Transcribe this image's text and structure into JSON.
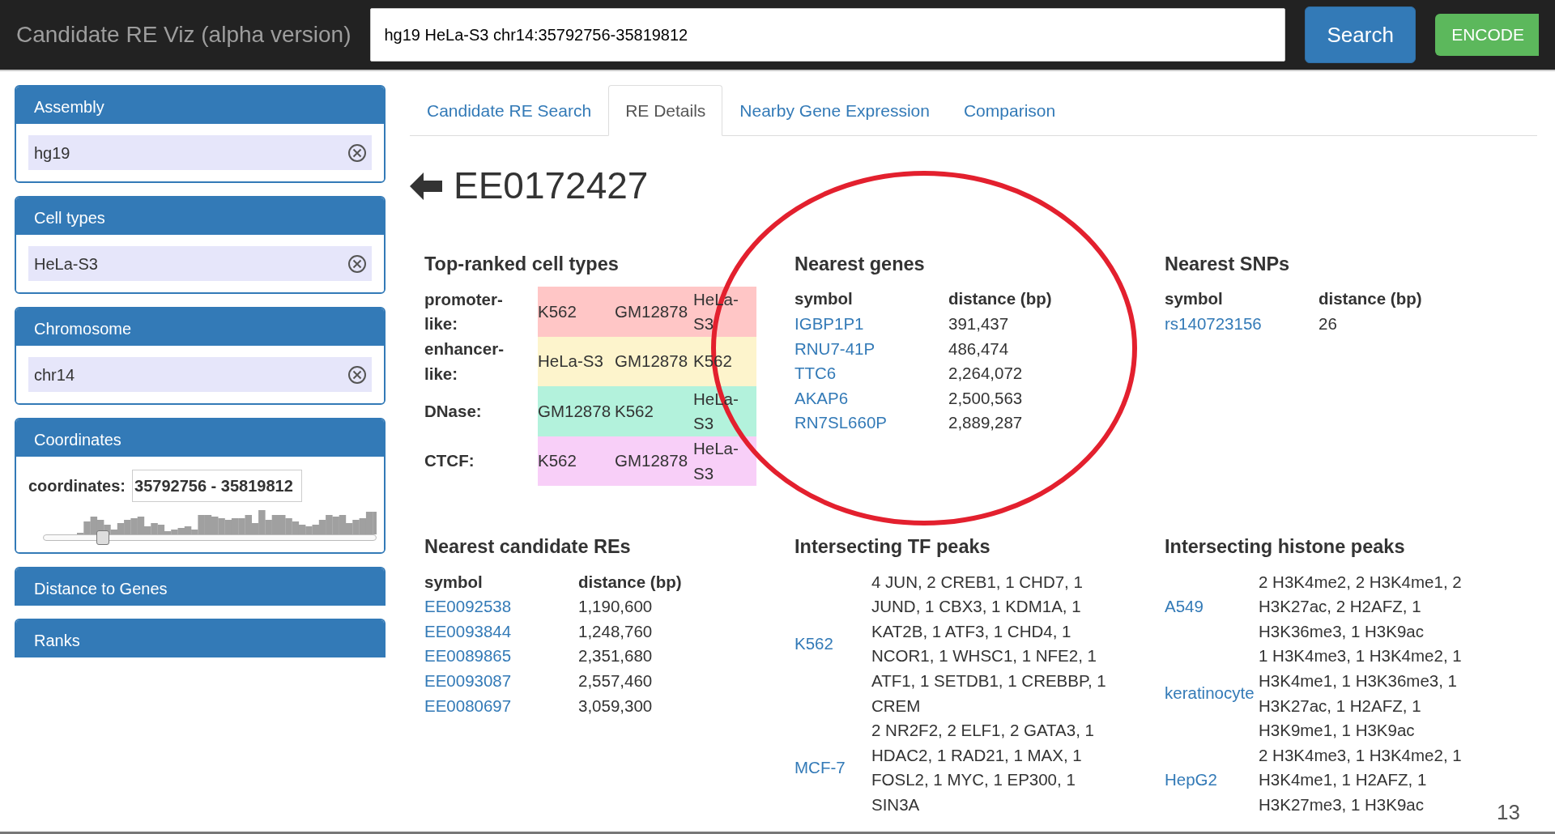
{
  "navbar": {
    "brand": "Candidate RE Viz (alpha version)",
    "search": {
      "value": "hg19 HeLa-S3 chr14:35792756-35819812"
    },
    "buttons": [
      {
        "label": "Search",
        "kind": "primary"
      },
      {
        "label": "ENCODE",
        "kind": "success"
      }
    ]
  },
  "sidebar": {
    "panels": [
      {
        "title": "Assembly",
        "kind": "chip",
        "value": "hg19"
      },
      {
        "title": "Cell types",
        "kind": "chip",
        "value": "HeLa-S3"
      },
      {
        "title": "Chromosome",
        "kind": "chip",
        "value": "chr14"
      },
      {
        "title": "Coordinates",
        "kind": "range",
        "label": "coordinates:",
        "value": "35792756 - 35819812",
        "level": 0.18
      },
      {
        "title": "Distance to Genes",
        "kind": "collapsed"
      },
      {
        "title": "Ranks",
        "kind": "collapsed"
      }
    ]
  },
  "tabs": [
    {
      "label": "Candidate RE Search",
      "selected": false
    },
    {
      "label": "RE Details",
      "selected": true
    },
    {
      "label": "Nearby Gene Expression",
      "selected": false
    },
    {
      "label": "Comparison",
      "selected": false
    }
  ],
  "heading": "EE0172427",
  "top_ranked": {
    "title": "Top-ranked cell types",
    "rows": [
      {
        "label": "promoter-like:",
        "color": "#ffc6c6",
        "cells": [
          "K562",
          "GM12878",
          "HeLa-S3"
        ]
      },
      {
        "label": "enhancer-like:",
        "color": "#fdf4cc",
        "cells": [
          "HeLa-S3",
          "GM12878",
          "K562"
        ]
      },
      {
        "label": "DNase:",
        "color": "#b3f2dc",
        "cells": [
          "GM12878",
          "K562",
          "HeLa-S3"
        ]
      },
      {
        "label": "CTCF:",
        "color": "#f8cff8",
        "cells": [
          "K562",
          "GM12878",
          "HeLa-S3"
        ]
      }
    ]
  },
  "nearest_genes": {
    "title": "Nearest genes",
    "columns": [
      "symbol",
      "distance (bp)"
    ],
    "rows": [
      [
        "IGBP1P1",
        "391,437"
      ],
      [
        "RNU7-41P",
        "486,474"
      ],
      [
        "TTC6",
        "2,264,072"
      ],
      [
        "AKAP6",
        "2,500,563"
      ],
      [
        "RN7SL660P",
        "2,889,287"
      ]
    ]
  },
  "nearest_snps": {
    "title": "Nearest SNPs",
    "columns": [
      "symbol",
      "distance (bp)"
    ],
    "rows": [
      [
        "rs140723156",
        "26"
      ]
    ]
  },
  "nearest_res": {
    "title": "Nearest candidate REs",
    "columns": [
      "symbol",
      "distance (bp)"
    ],
    "rows": [
      [
        "EE0092538",
        "1,190,600"
      ],
      [
        "EE0093844",
        "1,248,760"
      ],
      [
        "EE0089865",
        "2,351,680"
      ],
      [
        "EE0093087",
        "2,557,460"
      ],
      [
        "EE0080697",
        "3,059,300"
      ]
    ]
  },
  "tf_peaks": {
    "title": "Intersecting TF peaks",
    "rows": [
      {
        "cell_type": "K562",
        "peaks": "4 JUN, 2 CREB1, 1 CHD7, 1 JUND, 1 CBX3, 1 KDM1A, 1 KAT2B, 1 ATF3, 1 CHD4, 1 NCOR1, 1 WHSC1, 1 NFE2, 1 ATF1, 1 SETDB1, 1 CREBBP, 1 CREM"
      },
      {
        "cell_type": "MCF-7",
        "peaks": "2 NR2F2, 2 ELF1, 2 GATA3, 1 HDAC2, 1 RAD21, 1 MAX, 1 FOSL2, 1 MYC, 1 EP300, 1 SIN3A"
      }
    ]
  },
  "histone_peaks": {
    "title": "Intersecting histone peaks",
    "rows": [
      {
        "cell_type": "A549",
        "peaks": "2 H3K4me2, 2 H3K4me1, 2 H3K27ac, 2 H2AFZ, 1 H3K36me3, 1 H3K9ac"
      },
      {
        "cell_type": "keratinocyte",
        "peaks": "1 H3K4me3, 1 H3K4me2, 1 H3K4me1, 1 H3K36me3, 1 H3K27ac, 1 H2AFZ, 1 H3K9me1, 1 H3K9ac"
      },
      {
        "cell_type": "HepG2",
        "peaks": "2 H3K4me3, 1 H3K4me2, 1 H3K4me1, 1 H2AFZ, 1 H3K27me3, 1 H3K9ac"
      }
    ]
  },
  "page_number": "13"
}
